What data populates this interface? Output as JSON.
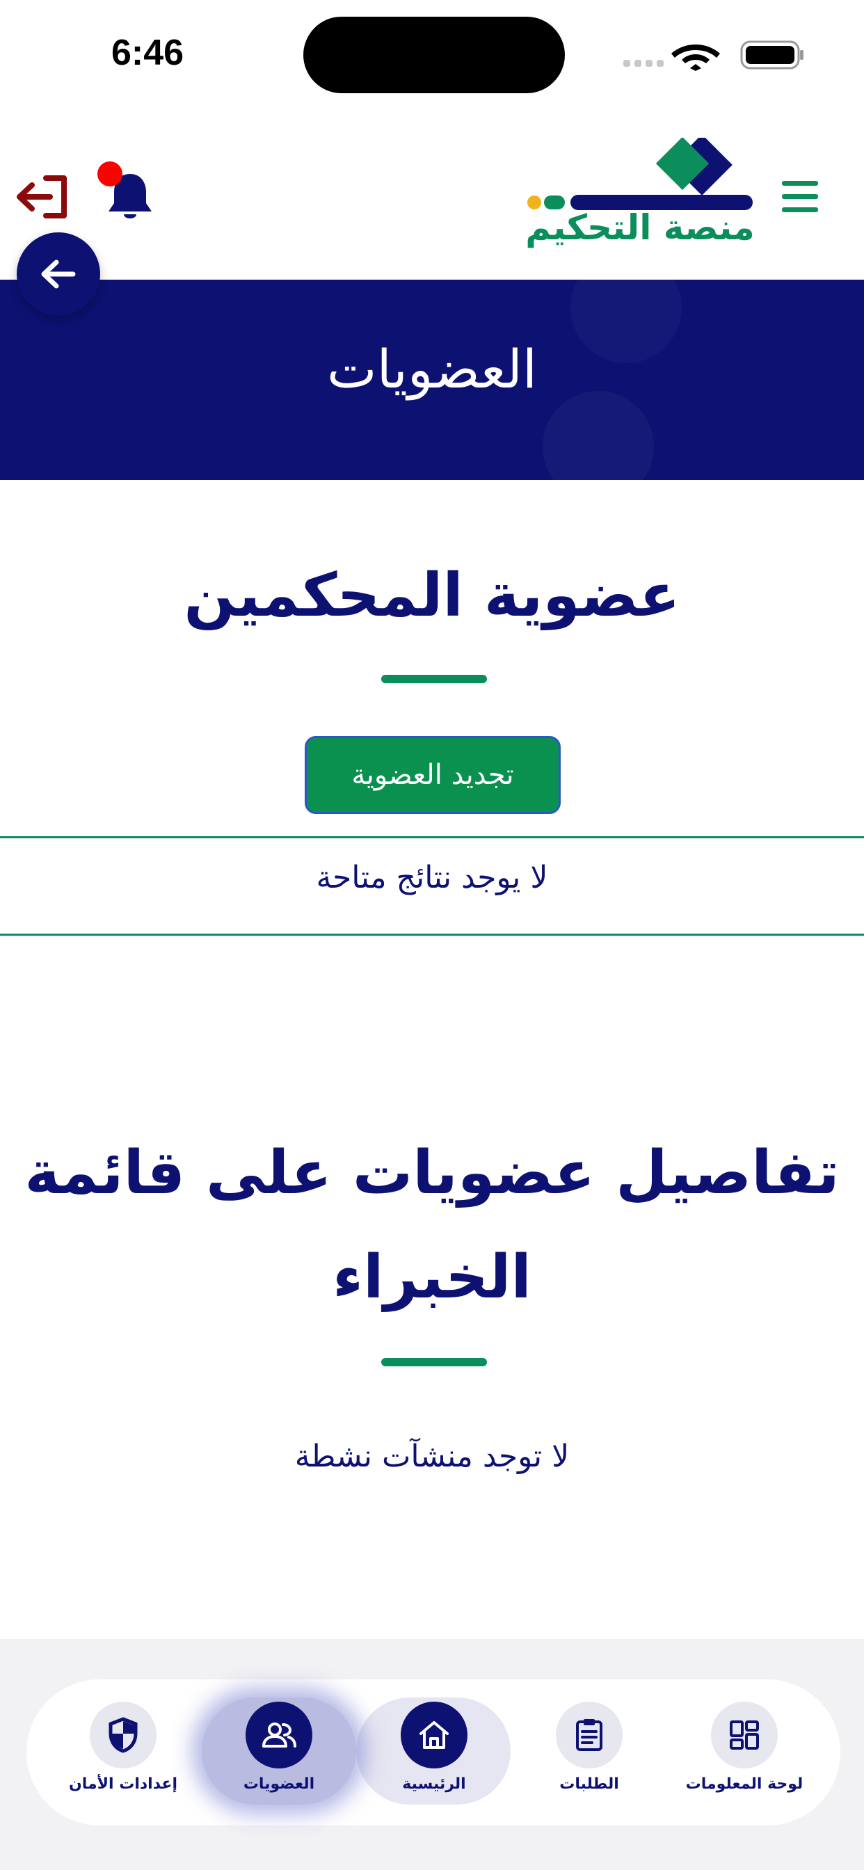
{
  "status_bar": {
    "time": "6:46"
  },
  "header": {
    "logo_text": "منصة التحكيم",
    "colors": {
      "brand_navy": "#0d1172",
      "brand_green": "#0b8e5c",
      "logout_red": "#8b0a0a",
      "notification_dot": "#ff0000"
    }
  },
  "banner": {
    "title": "العضويات"
  },
  "arbitrators_section": {
    "title": "عضوية المحكمين",
    "renew_button": "تجديد العضوية",
    "empty_message": "لا يوجد نتائج متاحة"
  },
  "experts_section": {
    "title_line1": "تفاصيل عضويات على قائمة",
    "title_line2": "الخبراء",
    "empty_message": "لا توجد منشآت نشطة"
  },
  "bottom_nav": {
    "items": [
      {
        "label": "إعدادات الأمان",
        "icon": "shield-icon"
      },
      {
        "label": "العضويات",
        "icon": "users-icon",
        "active": true
      },
      {
        "label": "الرئيسية",
        "icon": "home-icon"
      },
      {
        "label": "الطلبات",
        "icon": "clipboard-icon"
      },
      {
        "label": "لوحة المعلومات",
        "icon": "dashboard-icon"
      }
    ]
  }
}
